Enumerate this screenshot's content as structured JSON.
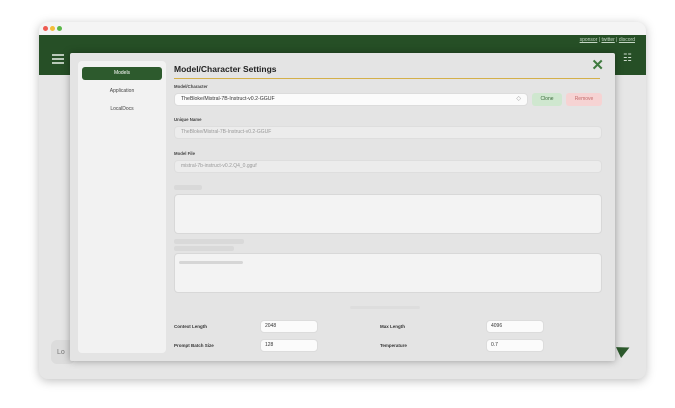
{
  "window": {
    "top_links": [
      "sponsor",
      "twitter",
      "discord"
    ]
  },
  "bottom_bar": {
    "input_prefix": "Lo"
  },
  "modal": {
    "title": "Model/Character Settings",
    "sidebar": {
      "items": [
        {
          "label": "Models",
          "active": true
        },
        {
          "label": "Application",
          "active": false
        },
        {
          "label": "LocalDocs",
          "active": false
        }
      ]
    },
    "model_character": {
      "label": "Model/Character",
      "value": "TheBloke/Mistral-7B-Instruct-v0.2-GGUF",
      "clone_label": "Clone",
      "remove_label": "Remove"
    },
    "unique_name": {
      "label": "Unique Name",
      "value": "TheBloke/Mistral-7B-Instruct-v0.2-GGUF"
    },
    "model_file": {
      "label": "Model File",
      "value": "mistral-7b-instruct-v0.2.Q4_0.gguf"
    },
    "params": {
      "context_length": {
        "label": "Context Length",
        "value": "2048"
      },
      "max_length": {
        "label": "Max Length",
        "value": "4096"
      },
      "prompt_batch_size": {
        "label": "Prompt Batch Size",
        "value": "128"
      },
      "temperature": {
        "label": "Temperature",
        "value": "0.7"
      }
    }
  },
  "colors": {
    "accent_green": "#2d5a2d",
    "title_rule": "#d4b04a",
    "remove_red": "#c46a6a"
  }
}
